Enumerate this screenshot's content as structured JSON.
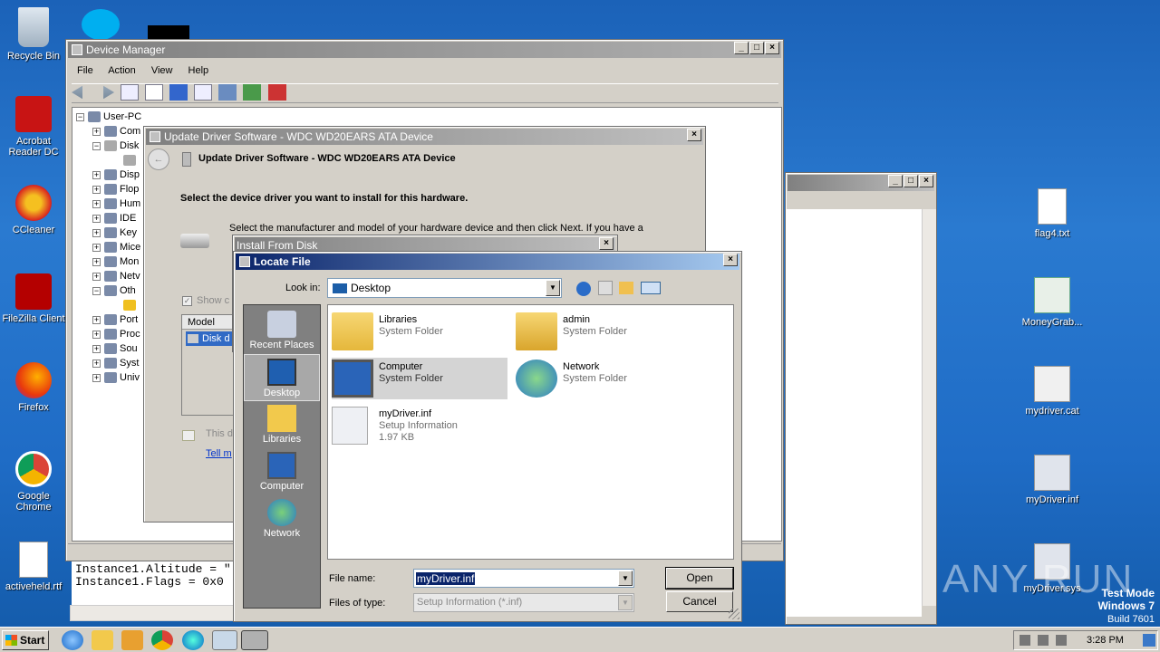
{
  "desktop": {
    "left_icons": [
      "Recycle Bin",
      "Acrobat Reader DC",
      "CCleaner",
      "FileZilla Client",
      "Firefox",
      "Google Chrome",
      "activeheld.rtf"
    ],
    "right_icons": [
      "flag4.txt",
      "MoneyGrab...",
      "mydriver.cat",
      "myDriver.inf",
      "myDriver.sys"
    ],
    "watermark": "ANY RUN",
    "os_line1": "Test Mode",
    "os_line2": "Windows 7",
    "os_line3": "Build 7601"
  },
  "device_manager": {
    "title": "Device Manager",
    "menu": [
      "File",
      "Action",
      "View",
      "Help"
    ],
    "tree": [
      "User-PC",
      "Com",
      "Disk",
      "",
      "Disp",
      "Flop",
      "Hum",
      "IDE",
      "Key",
      "Mice",
      "Mon",
      "Netv",
      "Oth",
      "",
      "Port",
      "Proc",
      "Sou",
      "Syst",
      "Univ"
    ]
  },
  "back_window": {
    "text_line1": "Instance1.Altitude = \"",
    "text_line2": "Instance1.Flags = 0x0"
  },
  "update_driver": {
    "title": "Update Driver Software - WDC WD20EARS ATA Device",
    "header": "Update Driver Software - WDC WD20EARS ATA Device",
    "heading": "Select the device driver you want to install for this hardware.",
    "description": "Select the manufacturer and model of your hardware device and then click Next. If you have a",
    "show_compat": "Show c",
    "model_header": "Model",
    "model_item": "Disk d",
    "signed_text": "This d",
    "tell_me": "Tell m"
  },
  "install_from_disk": {
    "title": "Install From Disk"
  },
  "locate_file": {
    "title": "Locate File",
    "look_in_label": "Look in:",
    "look_in_value": "Desktop",
    "places": [
      "Recent Places",
      "Desktop",
      "Libraries",
      "Computer",
      "Network"
    ],
    "files": [
      {
        "name": "Libraries",
        "type": "System Folder",
        "size": ""
      },
      {
        "name": "admin",
        "type": "System Folder",
        "size": ""
      },
      {
        "name": "Computer",
        "type": "System Folder",
        "size": ""
      },
      {
        "name": "Network",
        "type": "System Folder",
        "size": ""
      },
      {
        "name": "myDriver.inf",
        "type": "Setup Information",
        "size": "1.97 KB"
      }
    ],
    "file_name_label": "File name:",
    "file_name_value": "myDriver.inf",
    "file_type_label": "Files of type:",
    "file_type_value": "Setup Information (*.inf)",
    "open": "Open",
    "cancel": "Cancel"
  },
  "taskbar": {
    "start": "Start",
    "time": "3:28 PM"
  },
  "colors": {
    "title_active": "#0a246a",
    "desktop_blue": "#1f6cc6",
    "places_bg": "#808080"
  }
}
